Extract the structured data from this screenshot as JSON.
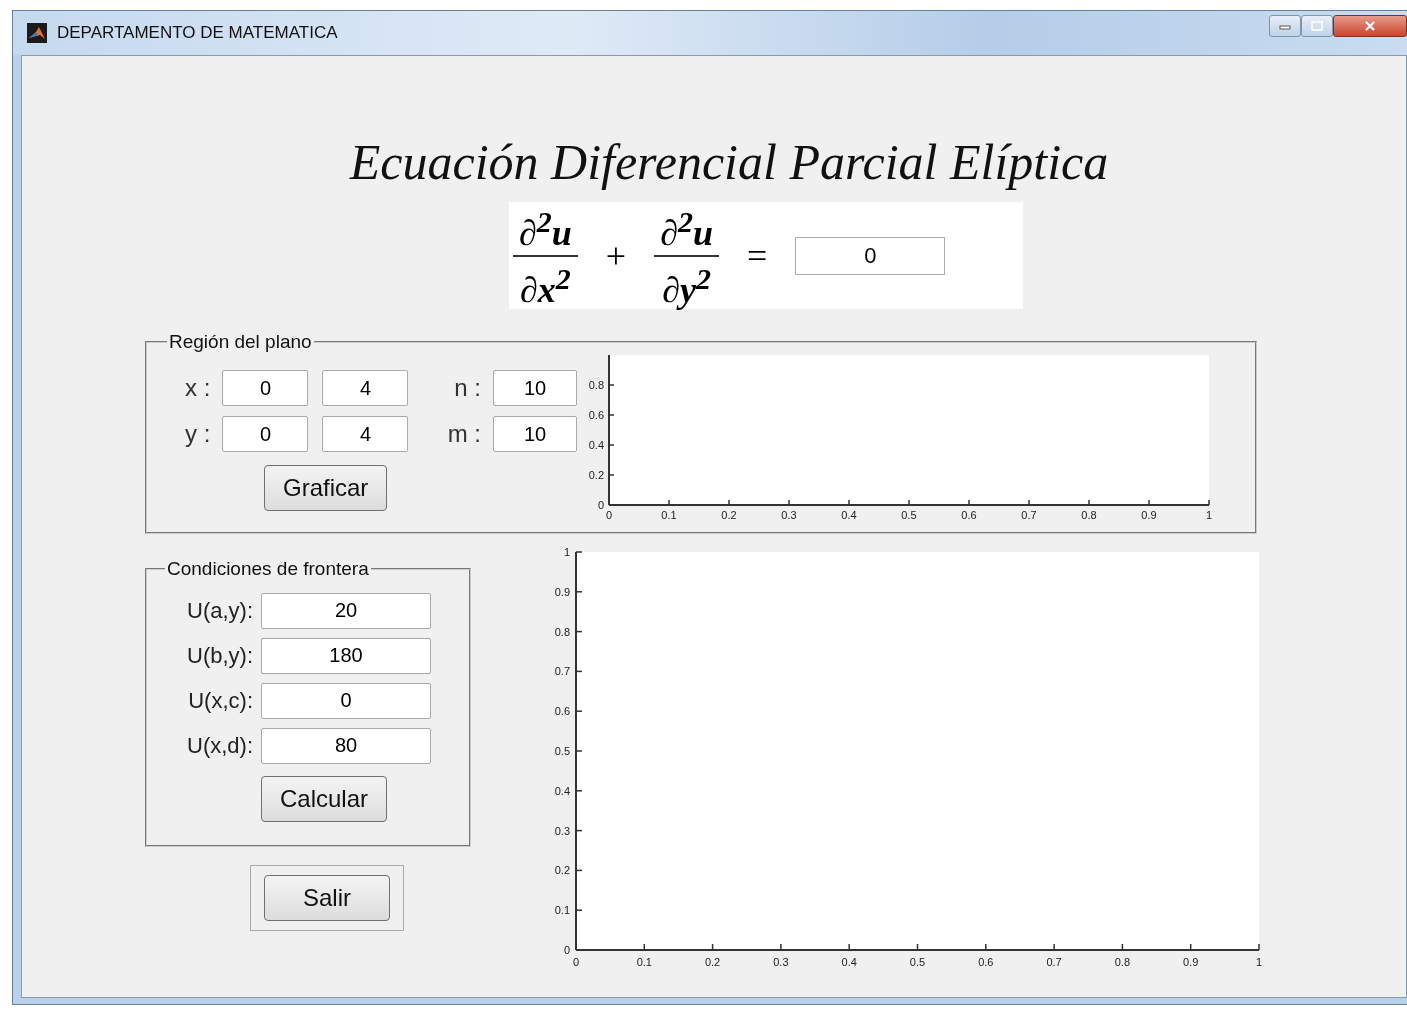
{
  "window": {
    "title": "DEPARTAMENTO DE MATEMATICA"
  },
  "heading": "Ecuación Diferencial Parcial Elíptica",
  "equation": {
    "term_1": {
      "numerator": "∂$^{2}$u",
      "denominator": "∂x$^{2}$"
    },
    "plus": "+",
    "term_2": {
      "numerator": "∂$^{2}$u",
      "denominator": "∂y$^{2}$"
    },
    "equals": "=",
    "value": "0"
  },
  "region_panel": {
    "title": "Región del plano",
    "rows": [
      {
        "label": "x :",
        "min": "0",
        "max": "4",
        "count_label": "n :",
        "count": "10"
      },
      {
        "label": "y :",
        "min": "0",
        "max": "4",
        "count_label": "m :",
        "count": "10"
      }
    ],
    "button": "Graficar",
    "chart_data": {
      "type": "line",
      "xlim": [
        0,
        1
      ],
      "ylim": [
        0,
        1
      ],
      "xticks": [
        0,
        0.1,
        0.2,
        0.3,
        0.4,
        0.5,
        0.6,
        0.7,
        0.8,
        0.9,
        1
      ],
      "yticks": [
        0,
        0.2,
        0.4,
        0.6,
        0.8
      ]
    }
  },
  "boundary_panel": {
    "title": "Condiciones de frontera",
    "rows": [
      {
        "label": "U(a,y):",
        "value": "20"
      },
      {
        "label": "U(b,y):",
        "value": "180"
      },
      {
        "label": "U(x,c):",
        "value": "0"
      },
      {
        "label": "U(x,d):",
        "value": "80"
      }
    ],
    "button": "Calcular"
  },
  "exit_button": "Salir",
  "result_chart": {
    "chart_data": {
      "type": "line",
      "xlim": [
        0,
        1
      ],
      "ylim": [
        0,
        1
      ],
      "xticks": [
        0,
        0.1,
        0.2,
        0.3,
        0.4,
        0.5,
        0.6,
        0.7,
        0.8,
        0.9,
        1
      ],
      "yticks": [
        0,
        0.1,
        0.2,
        0.3,
        0.4,
        0.5,
        0.6,
        0.7,
        0.8,
        0.9,
        1
      ]
    }
  }
}
